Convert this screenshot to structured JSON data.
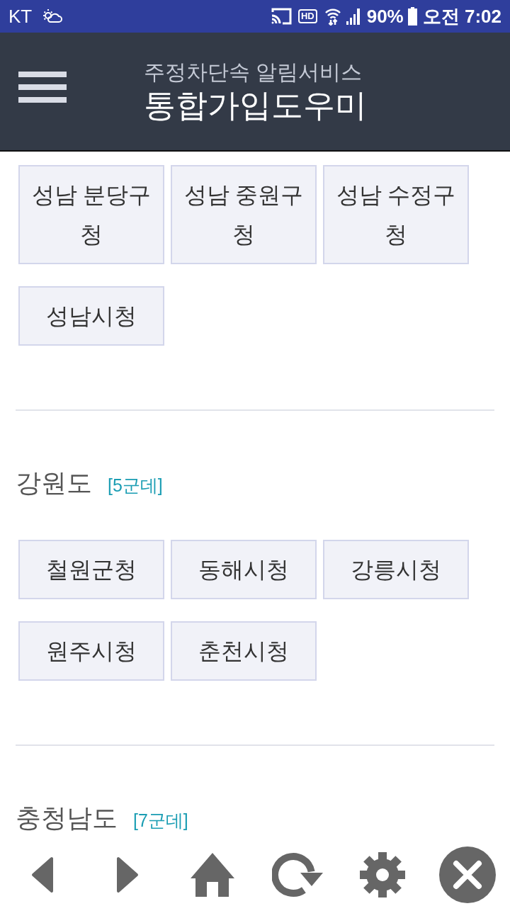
{
  "status_bar": {
    "carrier": "KT",
    "hd": "HD",
    "battery": "90%",
    "time": "오전 7:02"
  },
  "header": {
    "subtitle": "주정차단속 알림서비스",
    "title": "통합가입도우미"
  },
  "sections": [
    {
      "buttons": [
        "성남 분당구청",
        "성남 중원구청",
        "성남 수정구청",
        "성남시청"
      ]
    },
    {
      "title": "강원도",
      "count": "[5군데]",
      "buttons": [
        "철원군청",
        "동해시청",
        "강릉시청",
        "원주시청",
        "춘천시청"
      ]
    },
    {
      "title": "충청남도",
      "count": "[7군데]"
    }
  ]
}
